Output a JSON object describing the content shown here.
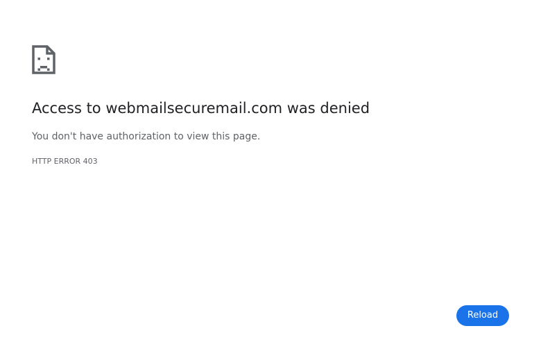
{
  "error": {
    "icon": "sad-document-icon",
    "title": "Access to webmailsecuremail.com was denied",
    "message": "You don't have authorization to view this page.",
    "code": "HTTP ERROR 403"
  },
  "actions": {
    "reload_label": "Reload"
  },
  "colors": {
    "icon": "#5f6368",
    "title": "#202124",
    "secondary_text": "#5f6368",
    "button_background": "#1a73e8",
    "button_text": "#ffffff"
  }
}
